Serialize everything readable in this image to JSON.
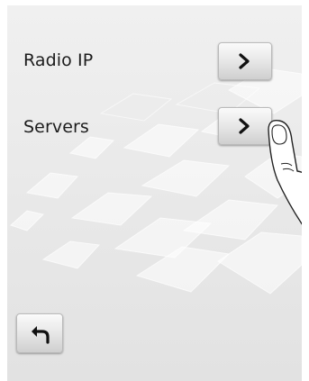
{
  "menu": {
    "items": [
      {
        "label": "Radio IP",
        "action_icon": "chevron-right-icon"
      },
      {
        "label": "Servers",
        "action_icon": "chevron-right-icon"
      }
    ]
  },
  "footer": {
    "back_icon": "back-arrow-icon"
  },
  "overlay": {
    "hand_icon": "pointing-finger-icon"
  },
  "colors": {
    "background": "#ececec",
    "text": "#1c1c1c",
    "button_face": "#e6e6e6",
    "icon": "#111111"
  }
}
